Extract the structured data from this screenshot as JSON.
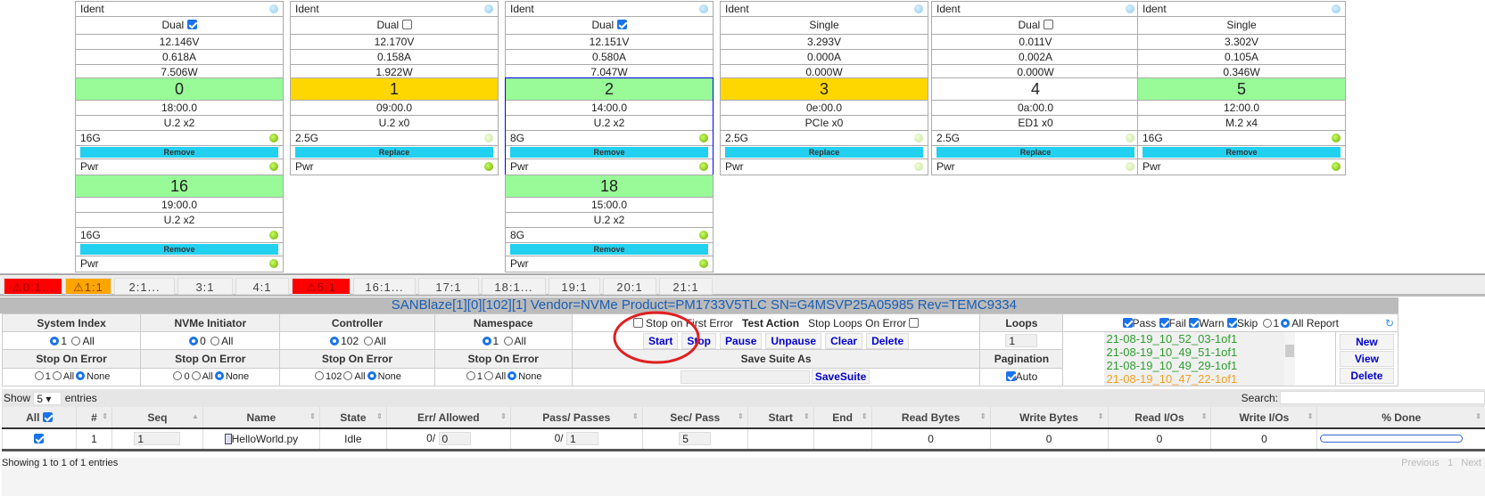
{
  "slots": [
    {
      "ident": "Ident",
      "mode": "Dual",
      "mode_checked": true,
      "volts": "12.146V",
      "amps": "0.618A",
      "watts": "7.506W",
      "num": "0",
      "status_color": "#98fb98",
      "addr": "18:00.0",
      "type": "U.2 x2",
      "speed": "16G",
      "speed_led": "green",
      "action": "Remove",
      "pwr": "Pwr",
      "pwr_led": "green"
    },
    {
      "ident": "Ident",
      "mode": "Dual",
      "mode_checked": false,
      "volts": "12.170V",
      "amps": "0.158A",
      "watts": "1.922W",
      "num": "1",
      "status_color": "#ffd700",
      "addr": "09:00.0",
      "type": "U.2 x0",
      "speed": "2.5G",
      "speed_led": "pale",
      "action": "Replace",
      "pwr": "Pwr",
      "pwr_led": "green"
    },
    {
      "ident": "Ident",
      "mode": "Dual",
      "mode_checked": true,
      "volts": "12.151V",
      "amps": "0.580A",
      "watts": "7.047W",
      "num": "2",
      "status_color": "#98fb98",
      "addr": "14:00.0",
      "type": "U.2 x2",
      "speed": "8G",
      "speed_led": "green",
      "action": "Remove",
      "pwr": "Pwr",
      "pwr_led": "green",
      "selected": true
    },
    {
      "ident": "Ident",
      "mode": "Single",
      "volts": "3.293V",
      "amps": "0.000A",
      "watts": "0.000W",
      "num": "3",
      "status_color": "#ffd700",
      "addr": "0e:00.0",
      "type": "PCIe x0",
      "speed": "2.5G",
      "speed_led": "pale",
      "action": "Replace",
      "pwr": "Pwr",
      "pwr_led": "pale"
    },
    {
      "ident": "Ident",
      "mode": "Dual",
      "mode_checked": false,
      "volts": "0.011V",
      "amps": "0.002A",
      "watts": "0.000W",
      "num": "4",
      "status_color": "#ffffff",
      "addr": "0a:00.0",
      "type": "ED1 x0",
      "speed": "2.5G",
      "speed_led": "pale",
      "action": "Replace",
      "pwr": "Pwr",
      "pwr_led": "pale"
    },
    {
      "ident": "Ident",
      "mode": "Single",
      "volts": "3.302V",
      "amps": "0.105A",
      "watts": "0.346W",
      "num": "5",
      "status_color": "#98fb98",
      "addr": "12:00.0",
      "type": "M.2 x4",
      "speed": "16G",
      "speed_led": "green",
      "action": "Remove",
      "pwr": "Pwr",
      "pwr_led": "green"
    }
  ],
  "slots2": [
    {
      "num": "16",
      "status_color": "#98fb98",
      "addr": "19:00.0",
      "type": "U.2 x2",
      "speed": "16G",
      "speed_led": "green",
      "action": "Remove",
      "pwr": "Pwr",
      "pwr_led": "green"
    },
    {
      "num": "18",
      "status_color": "#98fb98",
      "addr": "15:00.0",
      "type": "U.2 x2",
      "speed": "8G",
      "speed_led": "green",
      "action": "Remove",
      "pwr": "Pwr",
      "pwr_led": "green"
    }
  ],
  "tabs": [
    {
      "label": "0:1...",
      "state": "red",
      "warn": true
    },
    {
      "label": "1:1",
      "state": "orange",
      "warn": true
    },
    {
      "label": "2:1..."
    },
    {
      "label": "3:1"
    },
    {
      "label": "4:1"
    },
    {
      "label": "5:1",
      "state": "red",
      "warn": true
    },
    {
      "label": "16:1..."
    },
    {
      "label": "17:1"
    },
    {
      "label": "18:1..."
    },
    {
      "label": "19:1"
    },
    {
      "label": "20:1"
    },
    {
      "label": "21:1"
    }
  ],
  "device_title": "SANBlaze[1][0][102][1] Vendor=NVMe Product=PM1733V5TLC SN=G4MSVP25A05985 Rev=TEMC9334",
  "controls": {
    "headers": [
      "System Index",
      "NVMe Initiator",
      "Controller",
      "Namespace"
    ],
    "values": [
      "1",
      "0",
      "102",
      "1"
    ],
    "all": "All",
    "none": "None",
    "stop_on_error": "Stop On Error",
    "stop_first": "Stop on First Error",
    "test_action": "Test Action",
    "stop_loops": "Stop Loops On Error",
    "actions": [
      "Start",
      "Stop",
      "Pause",
      "Unpause",
      "Clear",
      "Delete"
    ],
    "save_suite_as": "Save Suite As",
    "save_suite": "SaveSuite",
    "loops_label": "Loops",
    "loops": "1",
    "pagination": "Pagination",
    "auto": "Auto",
    "filters": [
      "Pass",
      "Fail",
      "Warn",
      "Skip"
    ],
    "r1": "1",
    "all_report": "All Report",
    "reports": [
      {
        "name": "21-08-19_10_52_03-1of1",
        "color": "#2e9e2e"
      },
      {
        "name": "21-08-19_10_49_51-1of1",
        "color": "#2e9e2e"
      },
      {
        "name": "21-08-19_10_49_29-1of1",
        "color": "#2e9e2e"
      },
      {
        "name": "21-08-19_10_47_22-1of1",
        "color": "#f0a020"
      }
    ],
    "report_buttons": [
      "New",
      "View",
      "Delete"
    ]
  },
  "table": {
    "show": "Show",
    "show_value": "5",
    "entries": "entries",
    "search": "Search:",
    "columns": [
      "All",
      "#",
      "Seq",
      "Name",
      "State",
      "Err/ Allowed",
      "Pass/ Passes",
      "Sec/ Pass",
      "Start",
      "End",
      "Read Bytes",
      "Write Bytes",
      "Read I/Os",
      "Write I/Os",
      "% Done"
    ],
    "row": {
      "num": "1",
      "seq": "1",
      "name": "HelloWorld.py",
      "state": "Idle",
      "err": "0/",
      "allowed": "0",
      "pass": "0/",
      "passes": "1",
      "sec": "5",
      "start": "",
      "end": "",
      "read_bytes": "0",
      "write_bytes": "0",
      "read_ios": "0",
      "write_ios": "0",
      "done_percent": 0
    },
    "info": "Showing 1 to 1 of 1 entries",
    "prev": "Previous",
    "page": "1",
    "next": "Next"
  }
}
